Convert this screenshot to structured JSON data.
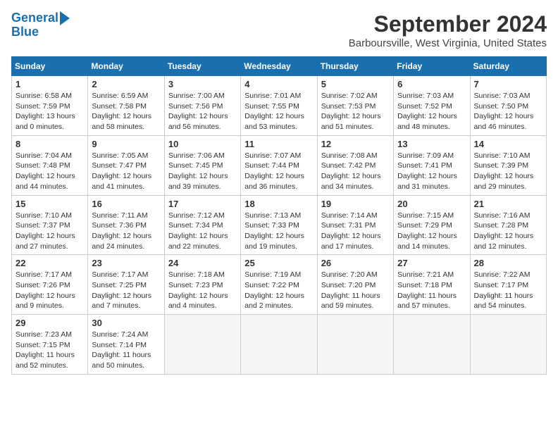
{
  "header": {
    "logo_line1": "General",
    "logo_line2": "Blue",
    "month_title": "September 2024",
    "location": "Barboursville, West Virginia, United States"
  },
  "days_of_week": [
    "Sunday",
    "Monday",
    "Tuesday",
    "Wednesday",
    "Thursday",
    "Friday",
    "Saturday"
  ],
  "weeks": [
    [
      {
        "day": 1,
        "info": "Sunrise: 6:58 AM\nSunset: 7:59 PM\nDaylight: 13 hours\nand 0 minutes."
      },
      {
        "day": 2,
        "info": "Sunrise: 6:59 AM\nSunset: 7:58 PM\nDaylight: 12 hours\nand 58 minutes."
      },
      {
        "day": 3,
        "info": "Sunrise: 7:00 AM\nSunset: 7:56 PM\nDaylight: 12 hours\nand 56 minutes."
      },
      {
        "day": 4,
        "info": "Sunrise: 7:01 AM\nSunset: 7:55 PM\nDaylight: 12 hours\nand 53 minutes."
      },
      {
        "day": 5,
        "info": "Sunrise: 7:02 AM\nSunset: 7:53 PM\nDaylight: 12 hours\nand 51 minutes."
      },
      {
        "day": 6,
        "info": "Sunrise: 7:03 AM\nSunset: 7:52 PM\nDaylight: 12 hours\nand 48 minutes."
      },
      {
        "day": 7,
        "info": "Sunrise: 7:03 AM\nSunset: 7:50 PM\nDaylight: 12 hours\nand 46 minutes."
      }
    ],
    [
      {
        "day": 8,
        "info": "Sunrise: 7:04 AM\nSunset: 7:48 PM\nDaylight: 12 hours\nand 44 minutes."
      },
      {
        "day": 9,
        "info": "Sunrise: 7:05 AM\nSunset: 7:47 PM\nDaylight: 12 hours\nand 41 minutes."
      },
      {
        "day": 10,
        "info": "Sunrise: 7:06 AM\nSunset: 7:45 PM\nDaylight: 12 hours\nand 39 minutes."
      },
      {
        "day": 11,
        "info": "Sunrise: 7:07 AM\nSunset: 7:44 PM\nDaylight: 12 hours\nand 36 minutes."
      },
      {
        "day": 12,
        "info": "Sunrise: 7:08 AM\nSunset: 7:42 PM\nDaylight: 12 hours\nand 34 minutes."
      },
      {
        "day": 13,
        "info": "Sunrise: 7:09 AM\nSunset: 7:41 PM\nDaylight: 12 hours\nand 31 minutes."
      },
      {
        "day": 14,
        "info": "Sunrise: 7:10 AM\nSunset: 7:39 PM\nDaylight: 12 hours\nand 29 minutes."
      }
    ],
    [
      {
        "day": 15,
        "info": "Sunrise: 7:10 AM\nSunset: 7:37 PM\nDaylight: 12 hours\nand 27 minutes."
      },
      {
        "day": 16,
        "info": "Sunrise: 7:11 AM\nSunset: 7:36 PM\nDaylight: 12 hours\nand 24 minutes."
      },
      {
        "day": 17,
        "info": "Sunrise: 7:12 AM\nSunset: 7:34 PM\nDaylight: 12 hours\nand 22 minutes."
      },
      {
        "day": 18,
        "info": "Sunrise: 7:13 AM\nSunset: 7:33 PM\nDaylight: 12 hours\nand 19 minutes."
      },
      {
        "day": 19,
        "info": "Sunrise: 7:14 AM\nSunset: 7:31 PM\nDaylight: 12 hours\nand 17 minutes."
      },
      {
        "day": 20,
        "info": "Sunrise: 7:15 AM\nSunset: 7:29 PM\nDaylight: 12 hours\nand 14 minutes."
      },
      {
        "day": 21,
        "info": "Sunrise: 7:16 AM\nSunset: 7:28 PM\nDaylight: 12 hours\nand 12 minutes."
      }
    ],
    [
      {
        "day": 22,
        "info": "Sunrise: 7:17 AM\nSunset: 7:26 PM\nDaylight: 12 hours\nand 9 minutes."
      },
      {
        "day": 23,
        "info": "Sunrise: 7:17 AM\nSunset: 7:25 PM\nDaylight: 12 hours\nand 7 minutes."
      },
      {
        "day": 24,
        "info": "Sunrise: 7:18 AM\nSunset: 7:23 PM\nDaylight: 12 hours\nand 4 minutes."
      },
      {
        "day": 25,
        "info": "Sunrise: 7:19 AM\nSunset: 7:22 PM\nDaylight: 12 hours\nand 2 minutes."
      },
      {
        "day": 26,
        "info": "Sunrise: 7:20 AM\nSunset: 7:20 PM\nDaylight: 11 hours\nand 59 minutes."
      },
      {
        "day": 27,
        "info": "Sunrise: 7:21 AM\nSunset: 7:18 PM\nDaylight: 11 hours\nand 57 minutes."
      },
      {
        "day": 28,
        "info": "Sunrise: 7:22 AM\nSunset: 7:17 PM\nDaylight: 11 hours\nand 54 minutes."
      }
    ],
    [
      {
        "day": 29,
        "info": "Sunrise: 7:23 AM\nSunset: 7:15 PM\nDaylight: 11 hours\nand 52 minutes."
      },
      {
        "day": 30,
        "info": "Sunrise: 7:24 AM\nSunset: 7:14 PM\nDaylight: 11 hours\nand 50 minutes."
      },
      {
        "day": null,
        "info": ""
      },
      {
        "day": null,
        "info": ""
      },
      {
        "day": null,
        "info": ""
      },
      {
        "day": null,
        "info": ""
      },
      {
        "day": null,
        "info": ""
      }
    ]
  ]
}
